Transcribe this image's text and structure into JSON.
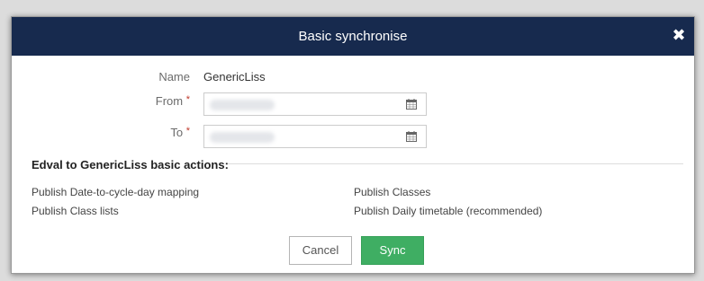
{
  "dialog": {
    "title": "Basic synchronise",
    "close_icon": "close-icon"
  },
  "form": {
    "name_label": "Name",
    "name_value": "GenericLiss",
    "from_label": "From",
    "to_label": "To",
    "required_marker": "*",
    "from_value": "",
    "to_value": "",
    "calendar_icon": "calendar-icon"
  },
  "actions": {
    "heading": "Edval to GenericLiss basic actions:",
    "items": [
      "Publish Date-to-cycle-day mapping",
      "Publish Class lists",
      "Publish Classes",
      "Publish Daily timetable (recommended)"
    ]
  },
  "buttons": {
    "cancel_label": "Cancel",
    "sync_label": "Sync"
  },
  "colors": {
    "header_bg": "#172a4e",
    "sync_bg": "#3fae63",
    "required": "#c0392b"
  }
}
